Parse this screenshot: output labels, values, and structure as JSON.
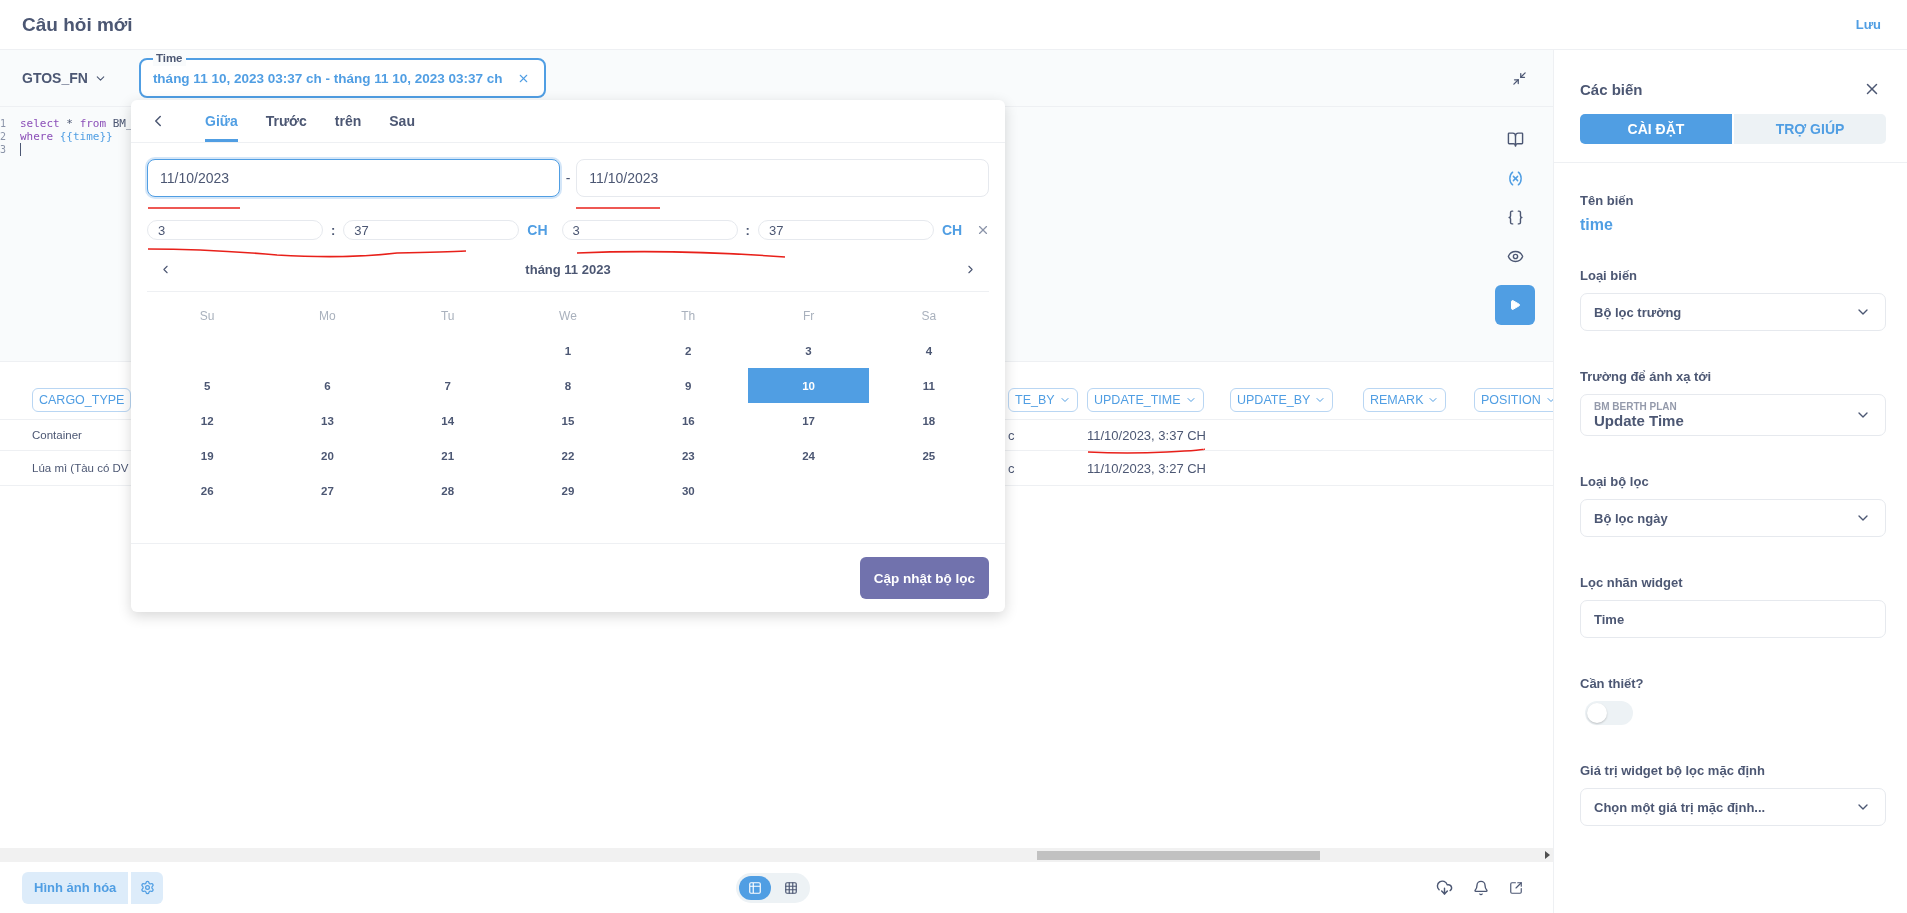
{
  "header": {
    "title": "Câu hỏi mới",
    "save": "Lưu"
  },
  "toolbar": {
    "database": "GTOS_FN",
    "time_widget": {
      "label": "Time",
      "value": "tháng 11 10, 2023 03:37 ch - tháng 11 10, 2023 03:37 ch"
    }
  },
  "editor": {
    "lines": [
      {
        "number": "1",
        "tokens": [
          {
            "text": "select",
            "kind": "keyword"
          },
          {
            "text": " * ",
            "kind": "plain"
          },
          {
            "text": "from",
            "kind": "keyword"
          },
          {
            "text": " BM_",
            "kind": "plain"
          }
        ]
      },
      {
        "number": "2",
        "tokens": [
          {
            "text": "where",
            "kind": "keyword"
          },
          {
            "text": " {{time}}",
            "kind": "variable"
          }
        ]
      },
      {
        "number": "3"
      }
    ],
    "side_icons": [
      {
        "kind": "book",
        "active": false
      },
      {
        "kind": "variables",
        "active": true
      },
      {
        "kind": "snippets",
        "active": false
      },
      {
        "kind": "preview",
        "active": false
      }
    ]
  },
  "popover": {
    "tabs": [
      {
        "label": "Giữa",
        "selected": true
      },
      {
        "label": "Trước",
        "selected": false
      },
      {
        "label": "trên",
        "selected": false
      },
      {
        "label": "Sau",
        "selected": false
      }
    ],
    "start_date": "11/10/2023",
    "end_date": "11/10/2023",
    "separator": "-",
    "time_separator": ":",
    "start_time": {
      "hour": "3",
      "minute": "37",
      "period": "CH"
    },
    "end_time": {
      "hour": "3",
      "minute": "37",
      "period": "CH"
    },
    "month": "tháng 11 2023",
    "weekdays": [
      "Su",
      "Mo",
      "Tu",
      "We",
      "Th",
      "Fr",
      "Sa"
    ],
    "weeks": [
      {
        "kind": "leading",
        "days": [
          {
            "day": "1",
            "selected": false
          },
          {
            "day": "2",
            "selected": false
          },
          {
            "day": "3",
            "selected": false
          },
          {
            "day": "4",
            "selected": false
          }
        ]
      },
      {
        "kind": "full",
        "days": [
          {
            "day": "5",
            "selected": false
          },
          {
            "day": "6",
            "selected": false
          },
          {
            "day": "7",
            "selected": false
          },
          {
            "day": "8",
            "selected": false
          },
          {
            "day": "9",
            "selected": false
          },
          {
            "day": "10",
            "selected": true
          },
          {
            "day": "11",
            "selected": false
          }
        ]
      },
      {
        "kind": "full",
        "days": [
          {
            "day": "12",
            "selected": false
          },
          {
            "day": "13",
            "selected": false
          },
          {
            "day": "14",
            "selected": false
          },
          {
            "day": "15",
            "selected": false
          },
          {
            "day": "16",
            "selected": false
          },
          {
            "day": "17",
            "selected": false
          },
          {
            "day": "18",
            "selected": false
          }
        ]
      },
      {
        "kind": "full",
        "days": [
          {
            "day": "19",
            "selected": false
          },
          {
            "day": "20",
            "selected": false
          },
          {
            "day": "21",
            "selected": false
          },
          {
            "day": "22",
            "selected": false
          },
          {
            "day": "23",
            "selected": false
          },
          {
            "day": "24",
            "selected": false
          },
          {
            "day": "25",
            "selected": false
          }
        ]
      },
      {
        "kind": "trailing",
        "days": [
          {
            "day": "26",
            "selected": false
          },
          {
            "day": "27",
            "selected": false
          },
          {
            "day": "28",
            "selected": false
          },
          {
            "day": "29",
            "selected": false
          },
          {
            "day": "30",
            "selected": false
          }
        ]
      }
    ],
    "submit": "Cập nhật bộ lọc"
  },
  "table": {
    "columns": [
      "CARGO_TYPE",
      "TE_BY",
      "UPDATE_TIME",
      "UPDATE_BY",
      "REMARK",
      "POSITION"
    ],
    "rows": [
      [
        "Container",
        "c",
        "11/10/2023, 3:37 CH"
      ],
      [
        "Lúa mì (Tàu có DV",
        "c",
        "11/10/2023, 3:27 CH"
      ]
    ]
  },
  "footer": {
    "visualize": "Hình ảnh hóa",
    "view": [
      {
        "kind": "table",
        "selected": true
      },
      {
        "kind": "grid",
        "selected": false
      }
    ]
  },
  "sidebar": {
    "title": "Các biến",
    "tabs": [
      {
        "label": "CÀI ĐẶT",
        "selected": true
      },
      {
        "label": "TRỢ GIÚP",
        "selected": false
      }
    ],
    "variable_name_label": "Tên biến",
    "variable_name": "time",
    "fields": [
      {
        "kind": "select",
        "label": "Loại biến",
        "value": "Bộ lọc trường"
      },
      {
        "kind": "select",
        "label": "Trường để ánh xạ tới",
        "caption": "BM BERTH PLAN",
        "value": "Update Time"
      },
      {
        "kind": "select",
        "label": "Loại bộ lọc",
        "value": "Bộ lọc ngày"
      },
      {
        "kind": "input",
        "label": "Lọc nhãn widget",
        "value": "Time"
      },
      {
        "kind": "toggle",
        "label": "Cần thiết?",
        "on": false
      },
      {
        "kind": "select",
        "label": "Giá trị widget bộ lọc mặc định",
        "value": "Chọn một giá trị mặc định..."
      }
    ]
  }
}
